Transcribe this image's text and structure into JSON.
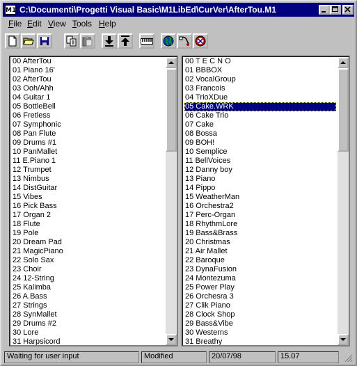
{
  "window": {
    "app_icon_text": "M1",
    "title": "C:\\Documenti\\Progetti Visual Basic\\M1LibEd\\CurVer\\AfterTou.M1"
  },
  "menu": [
    {
      "label_u": "F",
      "label_rest": "ile"
    },
    {
      "label_u": "E",
      "label_rest": "dit"
    },
    {
      "label_u": "V",
      "label_rest": "iew"
    },
    {
      "label_u": "T",
      "label_rest": "ools"
    },
    {
      "label_u": "H",
      "label_rest": "elp"
    }
  ],
  "toolbar_icons": [
    "new-file-icon",
    "open-folder-icon",
    "save-disk-icon",
    "copy-icon",
    "paste-icon",
    "download-arrow-icon",
    "upload-arrow-icon",
    "keyboard-icon",
    "globe-icon",
    "probe-icon",
    "no-entry-icon"
  ],
  "left_list": [
    "00 AfterTou",
    "01 Piano 16'",
    "02 AfterTou",
    "03 Ooh/Ahh",
    "04 Guitar 1",
    "05 BottleBell",
    "06 Fretless",
    "07 Symphonic",
    "08 Pan Flute",
    "09 Drums #1",
    "10 PanMallet",
    "11 E.Piano 1",
    "12 Trumpet",
    "13 Nimbus",
    "14 DistGuitar",
    "15 Vibes",
    "16 Pick Bass",
    "17 Organ 2",
    "18 Flute",
    "19 Pole",
    "20 Dream Pad",
    "21 MagicPiano",
    "22 Solo Sax",
    "23 Choir",
    "24 12-String",
    "25 Kalimba",
    "26 A.Bass",
    "27 Strings",
    "28 SynMallet",
    "29 Drums #2",
    "30 Lore",
    "31 Harpsicord"
  ],
  "right_list": [
    "00 T E C N O",
    "01 BBBOX",
    "02 VocalGroup",
    "03 Francois",
    "04 TrioXDue",
    "05 Cake.WRK",
    "06 Cake Trio",
    "07 Cake",
    "08 Bossa",
    "09 BOH!",
    "10 Semplice",
    "11 BellVoices",
    "12 Danny boy",
    "13 Piano",
    "14 Pippo",
    "15 WeatherMan",
    "16 Orchestra2",
    "17 Perc-Organ",
    "18 RhythmLore",
    "19 Bass&Brass",
    "20 Christmas",
    "21 Air Mallet",
    "22 Baroque",
    "23 DynaFusion",
    "24 Montezuma",
    "25 Power Play",
    "26 Orchesra 3",
    "27 Clik Piano",
    "28 Clock Shop",
    "29 Bass&Vibe",
    "30 Westerns",
    "31 Breathy"
  ],
  "right_selected_index": 5,
  "status": {
    "message": "Waiting for user input",
    "state": "Modified",
    "date": "20/07/98",
    "time": "15.07"
  }
}
